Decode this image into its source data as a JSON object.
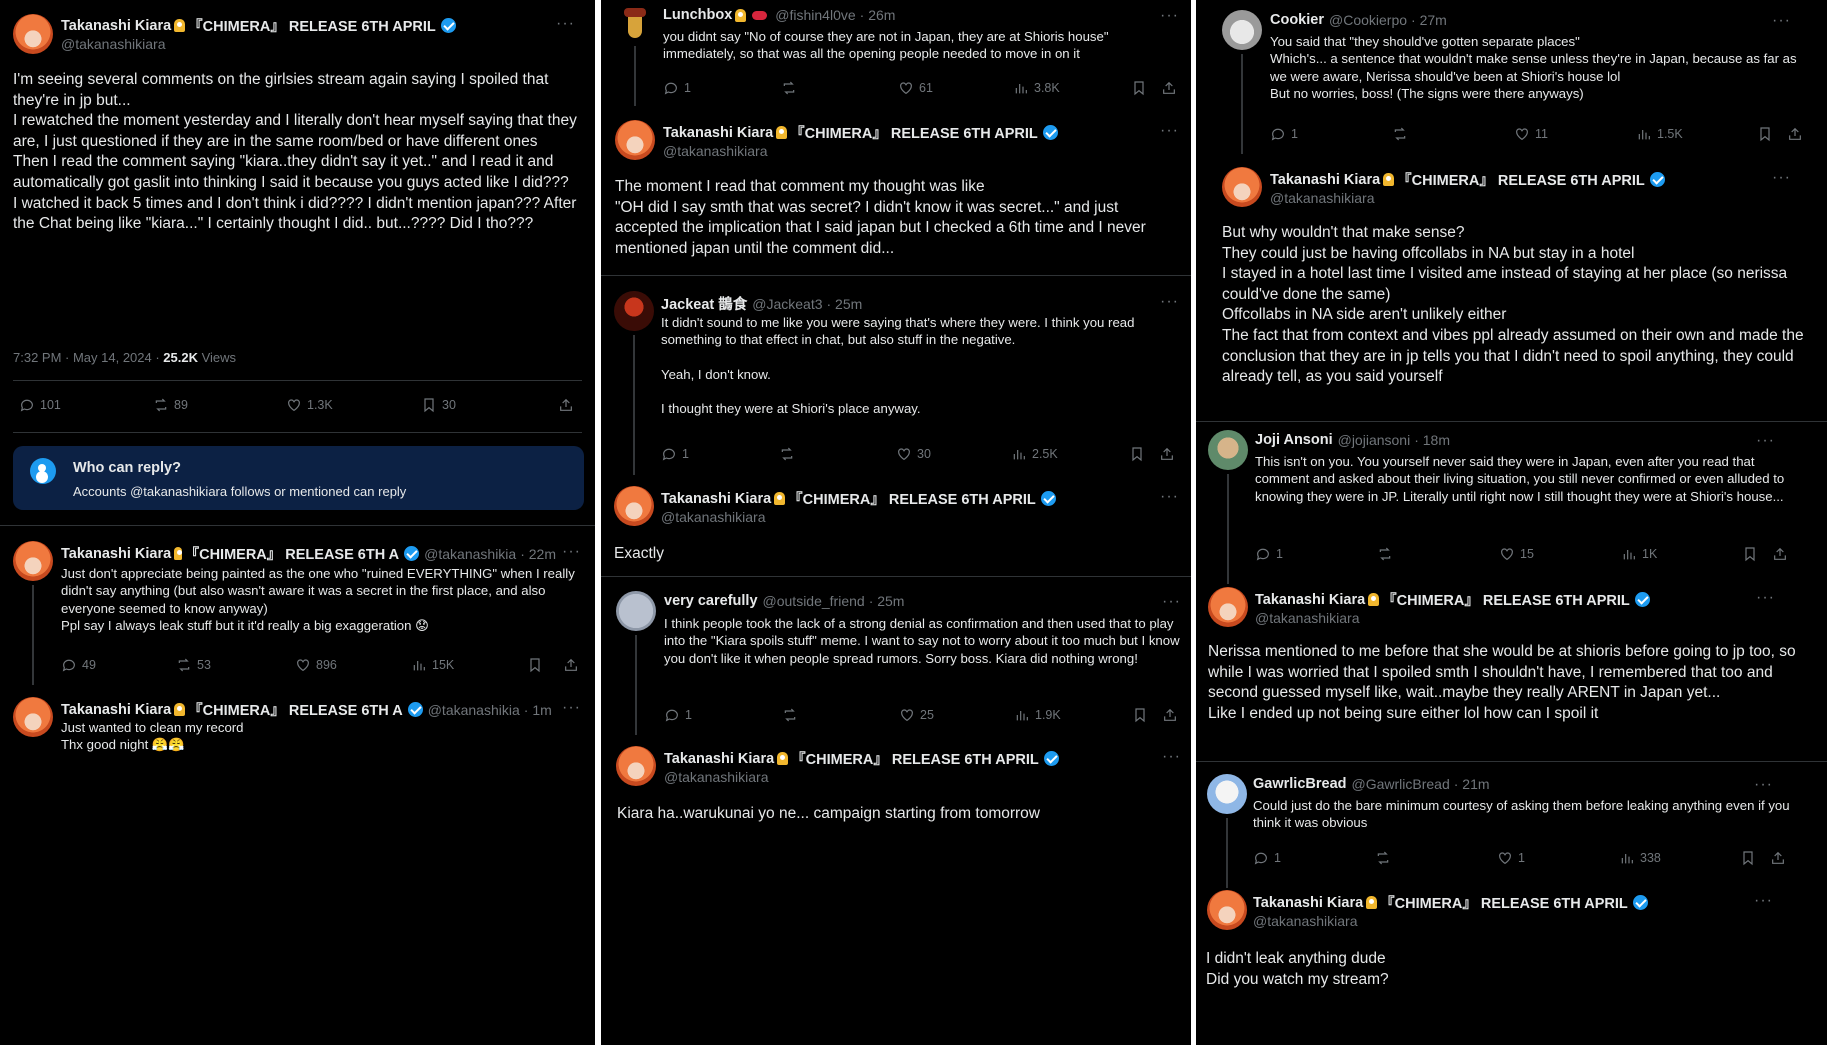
{
  "kiara": {
    "name": "Takanashi Kiara",
    "tag": "『CHIMERA』 RELEASE 6TH APRIL",
    "handle": "@takanashikiara"
  },
  "panel1": {
    "main": {
      "text": "I'm seeing several comments on the girlsies stream again saying I spoiled that they're in jp but...\nI rewatched the moment yesterday and I literally don't hear myself saying that they are, I just questioned if they are in the same room/bed or have different ones\nThen I read the comment saying \"kiara..they didn't say it yet..\" and I read it and automatically got gaslit into thinking I said it because you guys acted like I did???\nI watched it back 5 times and I don't think i did???? I didn't mention japan??? After the Chat being like \"kiara...\" I certainly thought I did.. but...???? Did I tho???",
      "time": "7:32 PM · May 14, 2024 · ",
      "views_count": "25.2K",
      "views_label": " Views",
      "stats": {
        "replies": "101",
        "reposts": "89",
        "likes": "1.3K",
        "bookmarks": "30"
      }
    },
    "who_can_reply": {
      "title": "Who can reply?",
      "desc": "Accounts @takanashikiara follows or mentioned can reply"
    },
    "reply1": {
      "name_trunc": "『CHIMERA』 RELEASE 6TH A",
      "handle": "@takanashikia",
      "time": "· 22m",
      "text": "Just don't appreciate being painted as the one who \"ruined EVERYTHING\" when I really didn't say anything (but also wasn't aware it was a secret in the first place, and also everyone seemed to know anyway)\nPpl say I always leak stuff but it it'd really a big exaggeration 😟",
      "stats": {
        "replies": "49",
        "reposts": "53",
        "likes": "896",
        "views": "15K"
      }
    },
    "reply2": {
      "name_trunc": "『CHIMERA』 RELEASE 6TH A",
      "handle": "@takanashikia",
      "time": "· 1m",
      "text": "Just wanted to clean my record\nThx good night 😤😤"
    }
  },
  "panel2": {
    "lunchbox": {
      "name": "Lunchbox",
      "handle": "@fishin4l0ve",
      "time": "· 26m",
      "text": "you didnt say \"No of course they are not in Japan, they are at Shioris house\" immediately, so that was all the opening people needed to move in on it",
      "stats": {
        "replies": "1",
        "reposts": "",
        "likes": "61",
        "views": "3.8K"
      }
    },
    "kiara1": {
      "text": "The moment I read that comment my thought was like\n\"OH did I say smth that was secret? I didn't know it was secret...\" and just accepted the implication that I said japan but I checked a 6th time and I never mentioned japan until the comment did..."
    },
    "jackeat": {
      "name": "Jackeat 鵲食",
      "handle": "@Jackeat3",
      "time": "· 25m",
      "text": "It didn't sound to me like you were saying that's where they were. I think you read something to that effect in chat, but also stuff in the negative.\n\nYeah, I don't know.\n\nI thought they were at Shiori's place anyway.",
      "stats": {
        "replies": "1",
        "reposts": "",
        "likes": "30",
        "views": "2.5K"
      }
    },
    "kiara2": {
      "text": "Exactly"
    },
    "carefully": {
      "name": "very carefully",
      "handle": "@outside_friend",
      "time": "· 25m",
      "text": "I think people took the lack of a strong denial as confirmation and then used that to play into the \"Kiara spoils stuff\" meme. I want to say not to worry about it too much but I know you don't like it when people spread rumors. Sorry boss. Kiara did nothing wrong!",
      "stats": {
        "replies": "1",
        "reposts": "",
        "likes": "25",
        "views": "1.9K"
      }
    },
    "kiara3": {
      "text": "Kiara ha..warukunai yo ne... campaign starting from tomorrow"
    }
  },
  "panel3": {
    "cookier": {
      "name": "Cookier",
      "handle": "@Cookierpo",
      "time": "· 27m",
      "text": "You said that \"they should've gotten separate places\"\nWhich's... a sentence that wouldn't make sense unless they're in Japan, because as far as we were aware, Nerissa should've been at Shiori's house lol\nBut no worries, boss! (The signs were there anyways)",
      "stats": {
        "replies": "1",
        "reposts": "",
        "likes": "11",
        "views": "1.5K"
      }
    },
    "kiara1": {
      "text": "But why wouldn't that make sense?\nThey could just be having offcollabs in NA but stay in a hotel\nI stayed in a hotel last time I visited ame instead of staying at her place (so nerissa could've done the same)\nOffcollabs in NA side aren't unlikely either\nThe fact that from context and vibes ppl already assumed on their own and made the conclusion that they are in jp tells you that I didn't need to spoil anything, they could already tell, as you said yourself"
    },
    "joji": {
      "name": "Joji Ansoni",
      "handle": "@jojiansoni",
      "time": "· 18m",
      "text": "This isn't on you. You yourself never said they were in Japan, even after you read that comment and asked about their living situation, you still never confirmed or even alluded to knowing they were in JP. Literally until right now I still thought they were at Shiori's house...",
      "stats": {
        "replies": "1",
        "reposts": "",
        "likes": "15",
        "views": "1K"
      }
    },
    "kiara2": {
      "text": "Nerissa mentioned to me before that she would be at shioris before going to jp too, so while I was worried that I spoiled smth I shouldn't have, I remembered that too and second guessed myself like, wait..maybe they really ARENT in Japan yet...\nLike I ended up not being sure either lol how can I spoil it"
    },
    "gawrlic": {
      "name": "GawrlicBread",
      "handle": "@GawrlicBread",
      "time": "· 21m",
      "text": "Could just do the bare minimum courtesy of asking them before leaking anything even if you think it was obvious",
      "stats": {
        "replies": "1",
        "reposts": "",
        "likes": "1",
        "views": "338"
      }
    },
    "kiara3": {
      "text": "I didn't leak anything dude\nDid you watch my stream?"
    }
  },
  "more_glyph": "···",
  "colors": {
    "background": "#000000",
    "text": "#e7e9ea",
    "muted": "#71767b",
    "accent": "#1d9bf0",
    "reply_box": "#0c2144"
  }
}
